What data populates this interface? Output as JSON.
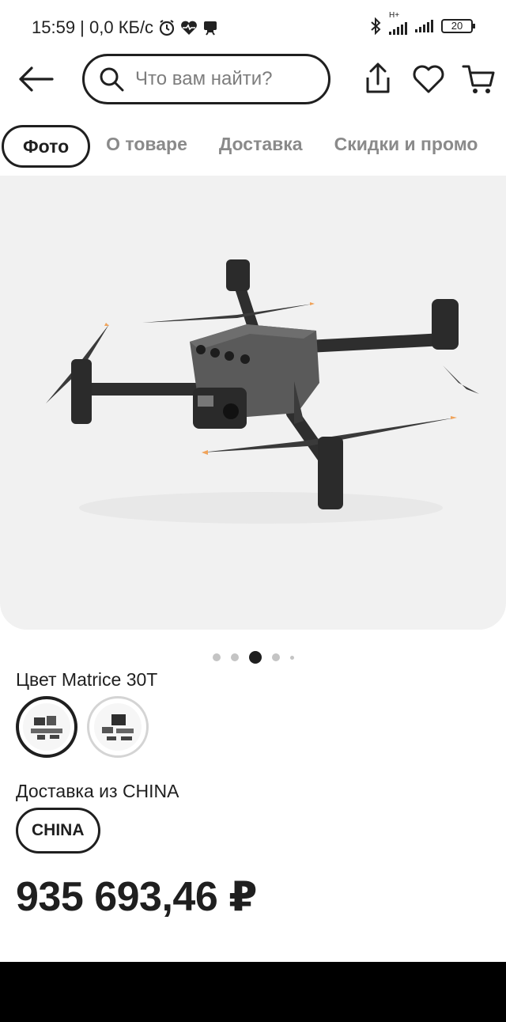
{
  "status_bar": {
    "time_speed": "15:59 | 0,0 КБ/с",
    "battery": "20",
    "network_label": "H+"
  },
  "header": {
    "search_placeholder": "Что вам найти?"
  },
  "tabs": [
    {
      "label": "Фото",
      "active": true
    },
    {
      "label": "О товаре",
      "active": false
    },
    {
      "label": "Доставка",
      "active": false
    },
    {
      "label": "Скидки и промо",
      "active": false
    }
  ],
  "carousel": {
    "dots": 5,
    "active_index": 2
  },
  "product": {
    "color_label": "Цвет Matrice 30T",
    "color_options": [
      {
        "name": "option-1",
        "selected": true
      },
      {
        "name": "option-2",
        "selected": false
      }
    ],
    "delivery_label": "Доставка из CHINA",
    "delivery_chip": "CHINA",
    "price": "935 693,46 ₽"
  },
  "colors": {
    "text": "#1f1f1f",
    "muted": "#8a8a8a",
    "photo_bg": "#f1f1f1",
    "accent_tip": "#f0a35a"
  }
}
